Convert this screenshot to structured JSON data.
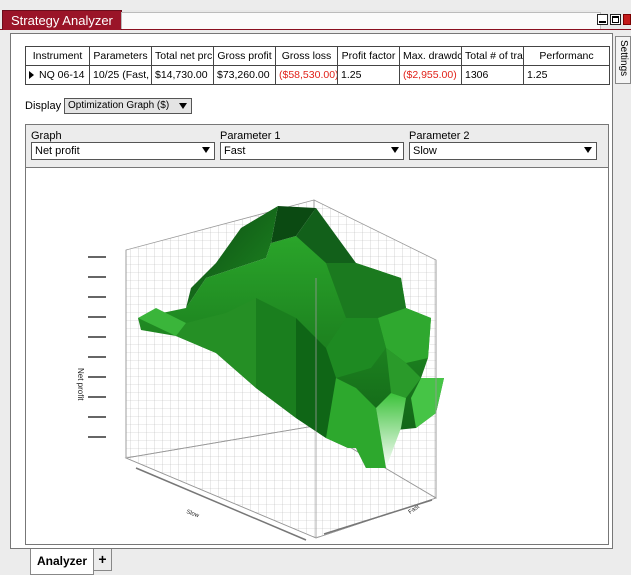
{
  "window": {
    "title": "Strategy Analyzer",
    "side_tab": "Settings"
  },
  "results": {
    "headers": [
      "Instrument",
      "Parameters",
      "Total net prc",
      "Gross profit",
      "Gross loss",
      "Profit factor",
      "Max. drawdc",
      "Total # of tra",
      "Performanc"
    ],
    "row": {
      "instrument": "NQ 06-14",
      "parameters": "10/25 (Fast,",
      "total_net_profit": "$14,730.00",
      "gross_profit": "$73,260.00",
      "gross_loss": "($58,530.00)",
      "profit_factor": "1.25",
      "max_drawdown": "($2,955.00)",
      "total_trades": "1306",
      "performance": "1.25"
    }
  },
  "display": {
    "label": "Display",
    "value": "Optimization Graph ($)"
  },
  "graph_params": {
    "graph_label": "Graph",
    "graph_value": "Net profit",
    "param1_label": "Parameter 1",
    "param1_value": "Fast",
    "param2_label": "Parameter 2",
    "param2_value": "Slow"
  },
  "plot": {
    "z_axis_label": "Net profit",
    "x_axis_label": "Fast",
    "y_axis_label": "Slow",
    "surface_color_dark": "#0b4a12",
    "surface_color_mid": "#1f8a22",
    "surface_color_light": "#3cc23a"
  },
  "bottom_tabs": {
    "active": "Analyzer",
    "add": "+"
  }
}
